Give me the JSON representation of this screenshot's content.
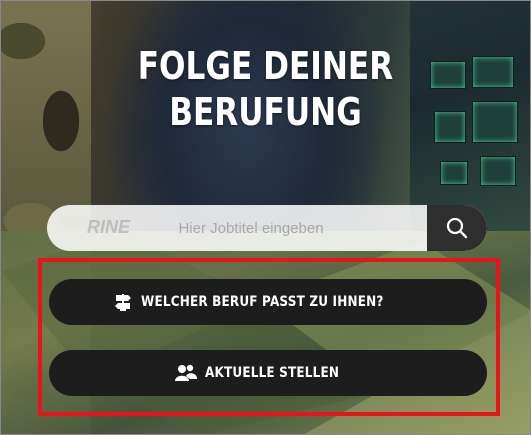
{
  "hero": {
    "headline_line1": "FOLGE DEINER",
    "headline_line2": "BERUFUNG"
  },
  "search": {
    "placeholder": "Hier Jobtitel eingeben",
    "button_icon": "search-icon"
  },
  "actions": {
    "beruf_label": "WELCHER BERUF PASST ZU IHNEN?",
    "beruf_icon": "direction-sign-icon",
    "stellen_label": "AKTUELLE STELLEN",
    "stellen_icon": "people-icon"
  },
  "colors": {
    "highlight_border": "#e8141b",
    "button_bg": "#1d1d1d",
    "text": "#ffffff"
  }
}
